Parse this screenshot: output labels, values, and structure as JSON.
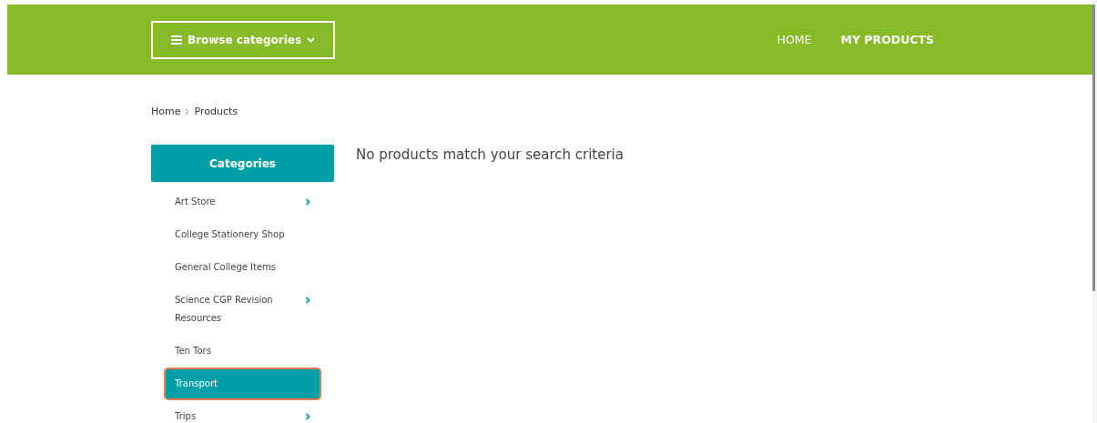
{
  "header": {
    "browse_button": "Browse categories",
    "nav": [
      {
        "label": "HOME",
        "selected": false
      },
      {
        "label": "MY PRODUCTS",
        "selected": true
      }
    ]
  },
  "breadcrumb": [
    "Home",
    "Products"
  ],
  "sidebar": {
    "title": "Categories",
    "items": [
      {
        "label": "Art Store",
        "selected": false,
        "has_children": true
      },
      {
        "label": "College Stationery Shop",
        "selected": false,
        "has_children": false
      },
      {
        "label": "General College Items",
        "selected": false,
        "has_children": false
      },
      {
        "label": "Science CGP Revision Resources",
        "selected": false,
        "has_children": true
      },
      {
        "label": "Ten Tors",
        "selected": false,
        "has_children": false
      },
      {
        "label": "Transport",
        "selected": true,
        "has_children": false
      },
      {
        "label": "Trips",
        "selected": false,
        "has_children": true
      }
    ]
  },
  "message": "No products match your search criteria"
}
